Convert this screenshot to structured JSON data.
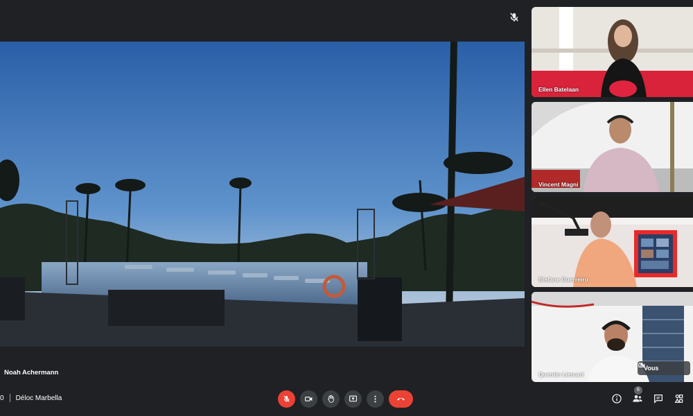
{
  "stage": {
    "speaker_name": "Noah Achermann"
  },
  "tiles": [
    {
      "name": "Ellen Batelaan"
    },
    {
      "name": "Vincent Magni"
    },
    {
      "name": "Stefane Guerreiro"
    },
    {
      "name": "Quentin Lienard",
      "self_label": "Vous"
    }
  ],
  "meeting": {
    "time": "0",
    "title": "Déloc Marbella"
  },
  "participants_count": "6",
  "colors": {
    "accent_red": "#ea4335",
    "control_bg": "#3c4043",
    "background": "#202124"
  },
  "icons": {
    "top": "mic-off-icon",
    "controls": [
      "mic-off-icon",
      "camera-icon",
      "raise-hand-icon",
      "present-icon",
      "more-options-icon",
      "end-call-icon"
    ],
    "right": [
      "info-icon",
      "people-icon",
      "chat-icon",
      "activities-icon"
    ]
  }
}
